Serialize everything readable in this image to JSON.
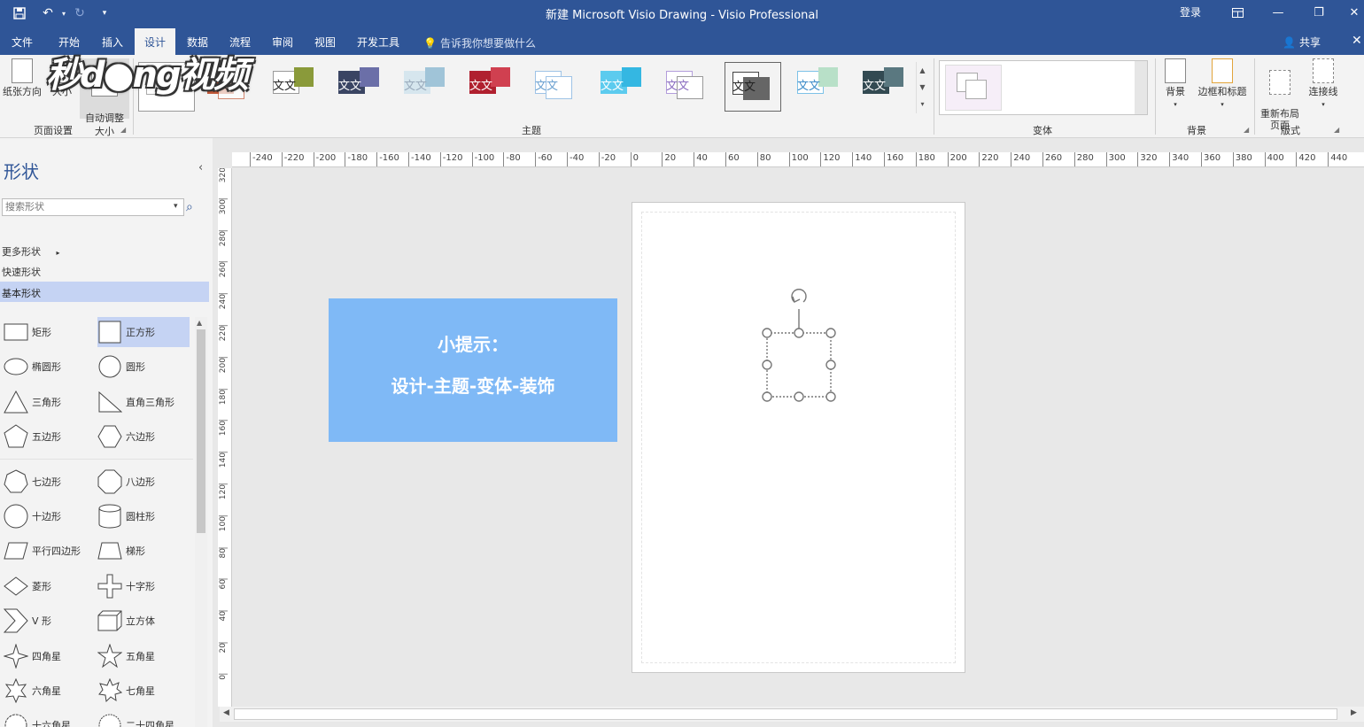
{
  "titlebar": {
    "title": "新建 Microsoft Visio Drawing  -  Visio Professional",
    "login": "登录"
  },
  "tabs": [
    {
      "label": "文件",
      "active": false
    },
    {
      "label": "开始",
      "active": false
    },
    {
      "label": "插入",
      "active": false
    },
    {
      "label": "设计",
      "active": true
    },
    {
      "label": "数据",
      "active": false
    },
    {
      "label": "流程",
      "active": false
    },
    {
      "label": "审阅",
      "active": false
    },
    {
      "label": "视图",
      "active": false
    },
    {
      "label": "开发工具",
      "active": false
    }
  ],
  "tell_me": "告诉我你想要做什么",
  "share": "共享",
  "ribbon": {
    "page_setup": {
      "label": "页面设置",
      "orientation": "纸张方向",
      "size": "大小",
      "auto_size": "自动调整\n大小"
    },
    "themes": {
      "label": "主题",
      "sample_text": "文文",
      "colors": [
        "#c55a3a",
        "#8a9a3a",
        "#3a4563",
        "#a0c4d8",
        "#b0202f",
        "#9ec3e6",
        "#34b7e2",
        "#b39ddb",
        "#444444",
        "#7dc2e8",
        "#334a52"
      ]
    },
    "variants": {
      "label": "变体"
    },
    "backgrounds": {
      "label": "背景",
      "background": "背景",
      "borders_titles": "边框和标题"
    },
    "layout": {
      "label": "版式",
      "relayout": "重新布局\n页面",
      "connectors": "连接线"
    }
  },
  "watermark": "秒懂视频",
  "shapes_panel": {
    "title": "形状",
    "search_placeholder": "搜索形状",
    "more_shapes": "更多形状",
    "quick_shapes": "快速形状",
    "basic_shapes": "基本形状",
    "items": [
      [
        "矩形",
        "正方形"
      ],
      [
        "椭圆形",
        "圆形"
      ],
      [
        "三角形",
        "直角三角形"
      ],
      [
        "五边形",
        "六边形"
      ],
      [
        "七边形",
        "八边形"
      ],
      [
        "十边形",
        "圆柱形"
      ],
      [
        "平行四边形",
        "梯形"
      ],
      [
        "菱形",
        "十字形"
      ],
      [
        "V 形",
        "立方体"
      ],
      [
        "四角星",
        "五角星"
      ],
      [
        "六角星",
        "七角星"
      ],
      [
        "十六角星",
        "二十四角星"
      ]
    ]
  },
  "rulers": {
    "h_ticks": [
      "-240",
      "-220",
      "-200",
      "-180",
      "-160",
      "-140",
      "-120",
      "-100",
      "-80",
      "-60",
      "-40",
      "-20",
      "0",
      "20",
      "40",
      "60",
      "80",
      "100",
      "120",
      "140",
      "160",
      "180",
      "200",
      "220",
      "240",
      "260",
      "280",
      "300",
      "320",
      "340",
      "360",
      "380",
      "400",
      "420",
      "440"
    ],
    "v_ticks": [
      "320",
      "300",
      "280",
      "260",
      "240",
      "220",
      "200",
      "180",
      "160",
      "140",
      "120",
      "100",
      "80",
      "60",
      "40",
      "20",
      "0"
    ]
  },
  "tip": {
    "line1": "小提示：",
    "line2": "设计-主题-变体-装饰"
  }
}
